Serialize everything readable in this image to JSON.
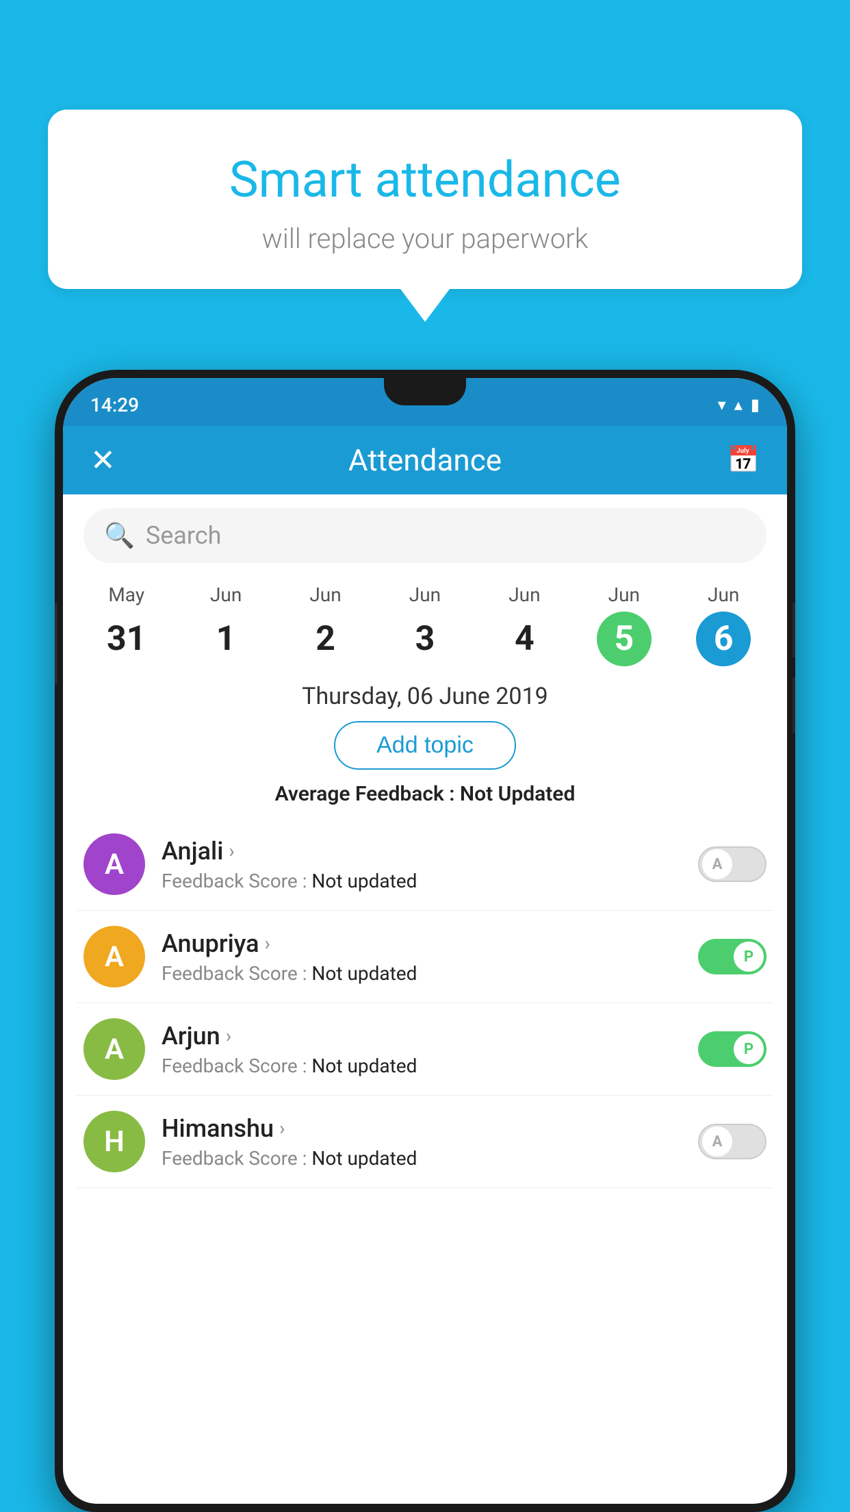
{
  "background_color": "#1ab8e8",
  "speech_bubble": {
    "title": "Smart attendance",
    "subtitle": "will replace your paperwork"
  },
  "status_bar": {
    "time": "14:29",
    "wifi_icon": "▼",
    "signal_icon": "▲",
    "battery_icon": "▮"
  },
  "header": {
    "title": "Attendance",
    "close_icon": "✕",
    "calendar_icon": "📅"
  },
  "search": {
    "placeholder": "Search"
  },
  "calendar": {
    "days": [
      {
        "month": "May",
        "date": "31",
        "style": "normal"
      },
      {
        "month": "Jun",
        "date": "1",
        "style": "normal"
      },
      {
        "month": "Jun",
        "date": "2",
        "style": "normal"
      },
      {
        "month": "Jun",
        "date": "3",
        "style": "normal"
      },
      {
        "month": "Jun",
        "date": "4",
        "style": "normal"
      },
      {
        "month": "Jun",
        "date": "5",
        "style": "today"
      },
      {
        "month": "Jun",
        "date": "6",
        "style": "selected"
      }
    ]
  },
  "selected_date": "Thursday, 06 June 2019",
  "add_topic_label": "Add topic",
  "average_feedback_label": "Average Feedback : ",
  "average_feedback_value": "Not Updated",
  "students": [
    {
      "name": "Anjali",
      "avatar_letter": "A",
      "avatar_color": "#a044cc",
      "feedback_label": "Feedback Score : ",
      "feedback_value": "Not updated",
      "toggle_state": "off",
      "toggle_label": "A"
    },
    {
      "name": "Anupriya",
      "avatar_letter": "A",
      "avatar_color": "#f0a820",
      "feedback_label": "Feedback Score : ",
      "feedback_value": "Not updated",
      "toggle_state": "on",
      "toggle_label": "P"
    },
    {
      "name": "Arjun",
      "avatar_letter": "A",
      "avatar_color": "#88bb44",
      "feedback_label": "Feedback Score : ",
      "feedback_value": "Not updated",
      "toggle_state": "on",
      "toggle_label": "P"
    },
    {
      "name": "Himanshu",
      "avatar_letter": "H",
      "avatar_color": "#88bb44",
      "feedback_label": "Feedback Score : ",
      "feedback_value": "Not updated",
      "toggle_state": "off",
      "toggle_label": "A"
    }
  ]
}
